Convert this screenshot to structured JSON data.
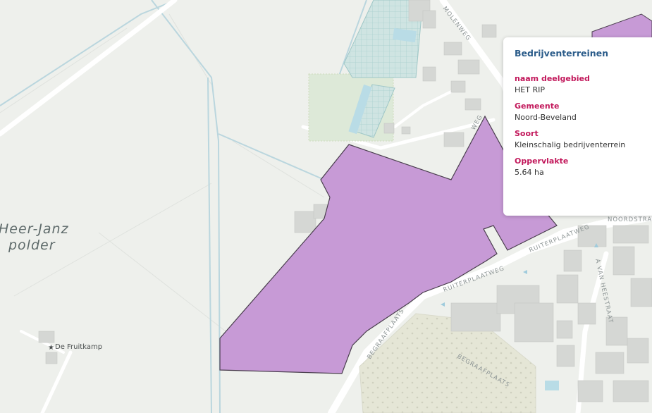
{
  "map": {
    "place_labels": {
      "polder_line1": "Heer-Janz",
      "polder_line2": "polder"
    },
    "poi": {
      "fruitkamp": "De Fruitkamp"
    },
    "streets": {
      "molenweg": "MOLENWEG",
      "ruiterplaatweg_1": "RUITERPLAATWEG",
      "ruiterplaatweg_2": "RUITERPLAATWEG",
      "begraafplaats_1": "BEGRAAFPLAATS",
      "begraafplaats_2": "BEGRAAFPLAATS",
      "van_heestraat": "A VAN HEESTRAAT",
      "noordstraat": "NOORDSTRA",
      "weg_partial": "WEG"
    },
    "colors": {
      "background": "#eef0ec",
      "feature_fill": "#c79ad6",
      "feature_stroke": "#4a3e4e",
      "road": "#ffffff",
      "water": "#b9dce6",
      "greenhouse": "#cfe3e1",
      "buildings": "#d5d7d4",
      "cemetery": "#e3e3d3"
    }
  },
  "popup": {
    "title": "Bedrijventerreinen",
    "fields": [
      {
        "label": "naam deelgebied",
        "value": "HET RIP"
      },
      {
        "label": "Gemeente",
        "value": "Noord-Beveland"
      },
      {
        "label": "Soort",
        "value": "Kleinschalig bedrijventerrein"
      },
      {
        "label": "Oppervlakte",
        "value": "5.64 ha"
      }
    ]
  }
}
